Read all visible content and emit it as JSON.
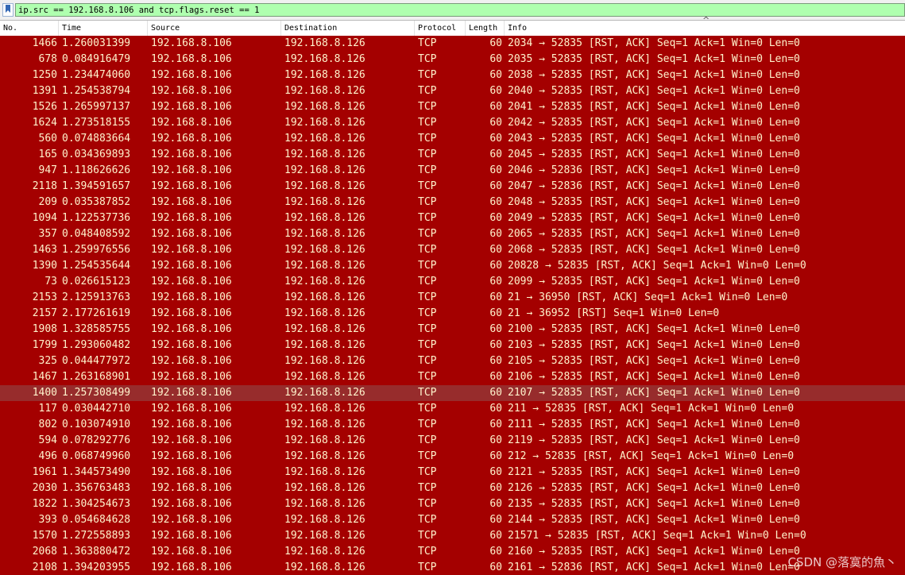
{
  "filter": {
    "expression": "ip.src == 192.168.8.106 and tcp.flags.reset == 1"
  },
  "columns": [
    "No.",
    "Time",
    "Source",
    "Destination",
    "Protocol",
    "Length",
    "Info"
  ],
  "sort_indicator": "^",
  "selected_row_index": 22,
  "packets": [
    {
      "no": "1466",
      "time": "1.260031399",
      "src": "192.168.8.106",
      "dst": "192.168.8.126",
      "proto": "TCP",
      "len": "60",
      "info": "2034 → 52835 [RST, ACK] Seq=1 Ack=1 Win=0 Len=0"
    },
    {
      "no": "678",
      "time": "0.084916479",
      "src": "192.168.8.106",
      "dst": "192.168.8.126",
      "proto": "TCP",
      "len": "60",
      "info": "2035 → 52835 [RST, ACK] Seq=1 Ack=1 Win=0 Len=0"
    },
    {
      "no": "1250",
      "time": "1.234474060",
      "src": "192.168.8.106",
      "dst": "192.168.8.126",
      "proto": "TCP",
      "len": "60",
      "info": "2038 → 52835 [RST, ACK] Seq=1 Ack=1 Win=0 Len=0"
    },
    {
      "no": "1391",
      "time": "1.254538794",
      "src": "192.168.8.106",
      "dst": "192.168.8.126",
      "proto": "TCP",
      "len": "60",
      "info": "2040 → 52835 [RST, ACK] Seq=1 Ack=1 Win=0 Len=0"
    },
    {
      "no": "1526",
      "time": "1.265997137",
      "src": "192.168.8.106",
      "dst": "192.168.8.126",
      "proto": "TCP",
      "len": "60",
      "info": "2041 → 52835 [RST, ACK] Seq=1 Ack=1 Win=0 Len=0"
    },
    {
      "no": "1624",
      "time": "1.273518155",
      "src": "192.168.8.106",
      "dst": "192.168.8.126",
      "proto": "TCP",
      "len": "60",
      "info": "2042 → 52835 [RST, ACK] Seq=1 Ack=1 Win=0 Len=0"
    },
    {
      "no": "560",
      "time": "0.074883664",
      "src": "192.168.8.106",
      "dst": "192.168.8.126",
      "proto": "TCP",
      "len": "60",
      "info": "2043 → 52835 [RST, ACK] Seq=1 Ack=1 Win=0 Len=0"
    },
    {
      "no": "165",
      "time": "0.034369893",
      "src": "192.168.8.106",
      "dst": "192.168.8.126",
      "proto": "TCP",
      "len": "60",
      "info": "2045 → 52835 [RST, ACK] Seq=1 Ack=1 Win=0 Len=0"
    },
    {
      "no": "947",
      "time": "1.118626626",
      "src": "192.168.8.106",
      "dst": "192.168.8.126",
      "proto": "TCP",
      "len": "60",
      "info": "2046 → 52836 [RST, ACK] Seq=1 Ack=1 Win=0 Len=0"
    },
    {
      "no": "2118",
      "time": "1.394591657",
      "src": "192.168.8.106",
      "dst": "192.168.8.126",
      "proto": "TCP",
      "len": "60",
      "info": "2047 → 52836 [RST, ACK] Seq=1 Ack=1 Win=0 Len=0"
    },
    {
      "no": "209",
      "time": "0.035387852",
      "src": "192.168.8.106",
      "dst": "192.168.8.126",
      "proto": "TCP",
      "len": "60",
      "info": "2048 → 52835 [RST, ACK] Seq=1 Ack=1 Win=0 Len=0"
    },
    {
      "no": "1094",
      "time": "1.122537736",
      "src": "192.168.8.106",
      "dst": "192.168.8.126",
      "proto": "TCP",
      "len": "60",
      "info": "2049 → 52835 [RST, ACK] Seq=1 Ack=1 Win=0 Len=0"
    },
    {
      "no": "357",
      "time": "0.048408592",
      "src": "192.168.8.106",
      "dst": "192.168.8.126",
      "proto": "TCP",
      "len": "60",
      "info": "2065 → 52835 [RST, ACK] Seq=1 Ack=1 Win=0 Len=0"
    },
    {
      "no": "1463",
      "time": "1.259976556",
      "src": "192.168.8.106",
      "dst": "192.168.8.126",
      "proto": "TCP",
      "len": "60",
      "info": "2068 → 52835 [RST, ACK] Seq=1 Ack=1 Win=0 Len=0"
    },
    {
      "no": "1390",
      "time": "1.254535644",
      "src": "192.168.8.106",
      "dst": "192.168.8.126",
      "proto": "TCP",
      "len": "60",
      "info": "20828 → 52835 [RST, ACK] Seq=1 Ack=1 Win=0 Len=0"
    },
    {
      "no": "73",
      "time": "0.026615123",
      "src": "192.168.8.106",
      "dst": "192.168.8.126",
      "proto": "TCP",
      "len": "60",
      "info": "2099 → 52835 [RST, ACK] Seq=1 Ack=1 Win=0 Len=0"
    },
    {
      "no": "2153",
      "time": "2.125913763",
      "src": "192.168.8.106",
      "dst": "192.168.8.126",
      "proto": "TCP",
      "len": "60",
      "info": "21 → 36950 [RST, ACK] Seq=1 Ack=1 Win=0 Len=0"
    },
    {
      "no": "2157",
      "time": "2.177261619",
      "src": "192.168.8.106",
      "dst": "192.168.8.126",
      "proto": "TCP",
      "len": "60",
      "info": "21 → 36952 [RST] Seq=1 Win=0 Len=0"
    },
    {
      "no": "1908",
      "time": "1.328585755",
      "src": "192.168.8.106",
      "dst": "192.168.8.126",
      "proto": "TCP",
      "len": "60",
      "info": "2100 → 52835 [RST, ACK] Seq=1 Ack=1 Win=0 Len=0"
    },
    {
      "no": "1799",
      "time": "1.293060482",
      "src": "192.168.8.106",
      "dst": "192.168.8.126",
      "proto": "TCP",
      "len": "60",
      "info": "2103 → 52835 [RST, ACK] Seq=1 Ack=1 Win=0 Len=0"
    },
    {
      "no": "325",
      "time": "0.044477972",
      "src": "192.168.8.106",
      "dst": "192.168.8.126",
      "proto": "TCP",
      "len": "60",
      "info": "2105 → 52835 [RST, ACK] Seq=1 Ack=1 Win=0 Len=0"
    },
    {
      "no": "1467",
      "time": "1.263168901",
      "src": "192.168.8.106",
      "dst": "192.168.8.126",
      "proto": "TCP",
      "len": "60",
      "info": "2106 → 52835 [RST, ACK] Seq=1 Ack=1 Win=0 Len=0"
    },
    {
      "no": "1400",
      "time": "1.257308499",
      "src": "192.168.8.106",
      "dst": "192.168.8.126",
      "proto": "TCP",
      "len": "60",
      "info": "2107 → 52835 [RST, ACK] Seq=1 Ack=1 Win=0 Len=0"
    },
    {
      "no": "117",
      "time": "0.030442710",
      "src": "192.168.8.106",
      "dst": "192.168.8.126",
      "proto": "TCP",
      "len": "60",
      "info": "211 → 52835 [RST, ACK] Seq=1 Ack=1 Win=0 Len=0"
    },
    {
      "no": "802",
      "time": "0.103074910",
      "src": "192.168.8.106",
      "dst": "192.168.8.126",
      "proto": "TCP",
      "len": "60",
      "info": "2111 → 52835 [RST, ACK] Seq=1 Ack=1 Win=0 Len=0"
    },
    {
      "no": "594",
      "time": "0.078292776",
      "src": "192.168.8.106",
      "dst": "192.168.8.126",
      "proto": "TCP",
      "len": "60",
      "info": "2119 → 52835 [RST, ACK] Seq=1 Ack=1 Win=0 Len=0"
    },
    {
      "no": "496",
      "time": "0.068749960",
      "src": "192.168.8.106",
      "dst": "192.168.8.126",
      "proto": "TCP",
      "len": "60",
      "info": "212 → 52835 [RST, ACK] Seq=1 Ack=1 Win=0 Len=0"
    },
    {
      "no": "1961",
      "time": "1.344573490",
      "src": "192.168.8.106",
      "dst": "192.168.8.126",
      "proto": "TCP",
      "len": "60",
      "info": "2121 → 52835 [RST, ACK] Seq=1 Ack=1 Win=0 Len=0"
    },
    {
      "no": "2030",
      "time": "1.356763483",
      "src": "192.168.8.106",
      "dst": "192.168.8.126",
      "proto": "TCP",
      "len": "60",
      "info": "2126 → 52835 [RST, ACK] Seq=1 Ack=1 Win=0 Len=0"
    },
    {
      "no": "1822",
      "time": "1.304254673",
      "src": "192.168.8.106",
      "dst": "192.168.8.126",
      "proto": "TCP",
      "len": "60",
      "info": "2135 → 52835 [RST, ACK] Seq=1 Ack=1 Win=0 Len=0"
    },
    {
      "no": "393",
      "time": "0.054684628",
      "src": "192.168.8.106",
      "dst": "192.168.8.126",
      "proto": "TCP",
      "len": "60",
      "info": "2144 → 52835 [RST, ACK] Seq=1 Ack=1 Win=0 Len=0"
    },
    {
      "no": "1570",
      "time": "1.272558893",
      "src": "192.168.8.106",
      "dst": "192.168.8.126",
      "proto": "TCP",
      "len": "60",
      "info": "21571 → 52835 [RST, ACK] Seq=1 Ack=1 Win=0 Len=0"
    },
    {
      "no": "2068",
      "time": "1.363880472",
      "src": "192.168.8.106",
      "dst": "192.168.8.126",
      "proto": "TCP",
      "len": "60",
      "info": "2160 → 52835 [RST, ACK] Seq=1 Ack=1 Win=0 Len=0"
    },
    {
      "no": "2108",
      "time": "1.394203955",
      "src": "192.168.8.106",
      "dst": "192.168.8.126",
      "proto": "TCP",
      "len": "60",
      "info": "2161 → 52836 [RST, ACK] Seq=1 Ack=1 Win=0 Len=0"
    }
  ],
  "watermark": "CSDN @落寞的魚丶"
}
